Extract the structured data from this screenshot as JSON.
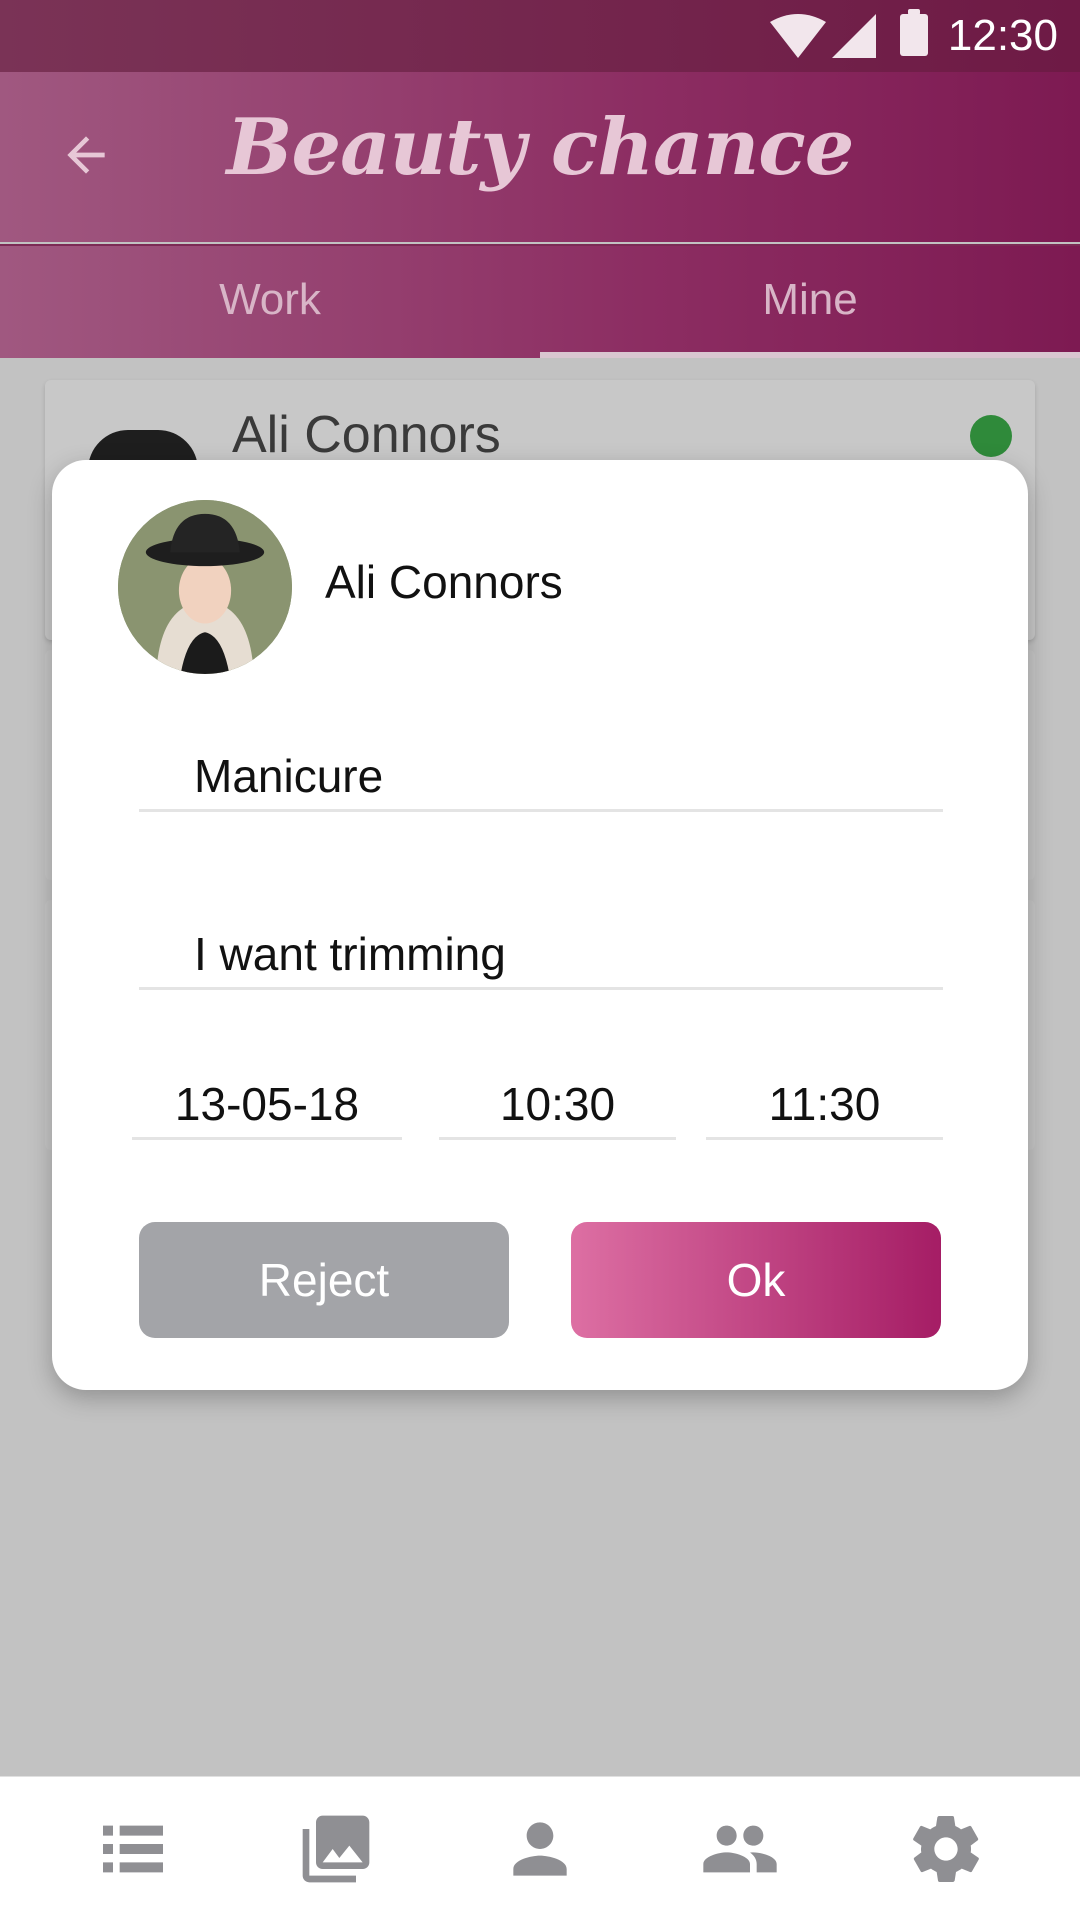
{
  "status_bar": {
    "time": "12:30"
  },
  "app_bar": {
    "title": "Beauty chance"
  },
  "tabs": [
    {
      "label": "Work"
    },
    {
      "label": "Mine"
    }
  ],
  "background_list": {
    "first_item_name": "Ali Connors"
  },
  "dialog": {
    "client_name": "Ali Connors",
    "service": "Manicure",
    "note": "I want trimming",
    "date": "13-05-18",
    "start_time": "10:30",
    "end_time": "11:30",
    "reject_label": "Reject",
    "ok_label": "Ok"
  },
  "bottom_nav": {
    "items": [
      "list-icon",
      "gallery-icon",
      "person-icon",
      "group-icon",
      "settings-icon"
    ],
    "icon_color": "#8f8f93"
  },
  "colors": {
    "accent_start": "#dd6fa3",
    "accent_end": "#a51d65",
    "reject_bg": "#a3a4a8"
  }
}
